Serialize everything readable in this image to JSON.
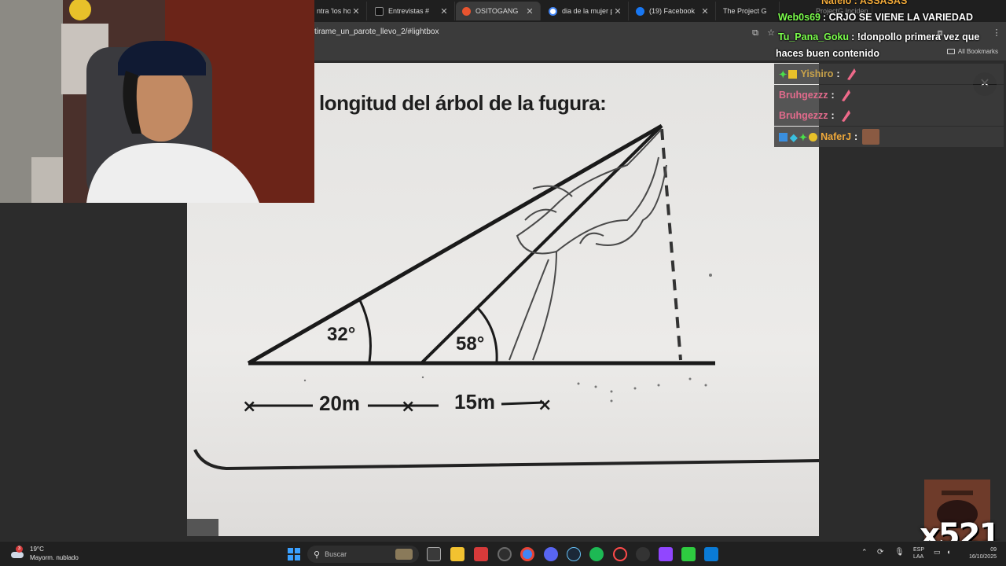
{
  "browser": {
    "tabs": [
      {
        "label": "ntra 'los ho",
        "active": false
      },
      {
        "label": "Entrevistas #",
        "active": false
      },
      {
        "label": "OSITOGANG",
        "active": true
      },
      {
        "label": "dia de la mujer p",
        "active": false
      },
      {
        "label": "(19) Facebook",
        "active": false
      },
      {
        "label": "The Project G",
        "active": false
      },
      {
        "label": "ProjectG Inciden",
        "active": false
      }
    ],
    "url": "tirame_un_parote_llevo_2/#lightbox",
    "all_bookmarks": "All Bookmarks"
  },
  "worksheet": {
    "prompt": "longitud del árbol de la fugura:",
    "angle_a": "32°",
    "angle_b": "58°",
    "dist_a": "20m",
    "dist_b": "15m"
  },
  "chat": {
    "partial_top": "Nafelo : ASSASAS",
    "messages": [
      {
        "user": "Web0s69",
        "text": "CRJO SE VIENE LA VARIEDAD",
        "color": "#7cff4d"
      },
      {
        "user": "Tu_Pana_Goku",
        "text": "!donpollo primera vez que",
        "color": "#7cff4d"
      }
    ],
    "continuation": "haces buen contenido",
    "rows": [
      {
        "user": "Yishiro",
        "color": "#c8a24a"
      },
      {
        "user": "Bruhgezzz",
        "color": "#e26b8c"
      },
      {
        "user": "Bruhgezzz",
        "color": "#e26b8c"
      },
      {
        "user": "NaferJ",
        "color": "#f0a93a"
      }
    ]
  },
  "counter": "x521",
  "taskbar": {
    "weather_temp": "19°C",
    "weather_desc": "Mayorm. nublado",
    "weather_badge": "3",
    "search_placeholder": "Buscar",
    "lang": "ESP",
    "lang2": "LAA",
    "time": "09",
    "date": "16/10/2025"
  }
}
